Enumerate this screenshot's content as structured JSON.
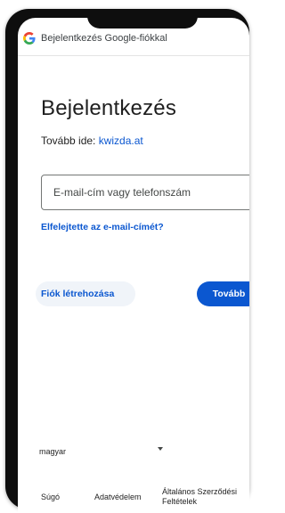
{
  "tab": {
    "logo_icon": "google-g-logo",
    "title": "Bejelentkezés Google-fiókkal"
  },
  "main": {
    "heading": "Bejelentkezés",
    "continue_prefix": "Tovább ide: ",
    "continue_domain": "kwizda.at",
    "email_placeholder": "E-mail-cím vagy telefonszám",
    "forgot_email": "Elfelejtette az e-mail-címét?",
    "create_account": "Fiók létrehozása",
    "next": "Tovább"
  },
  "footer": {
    "language": "magyar",
    "help": "Súgó",
    "privacy": "Adatvédelem",
    "terms": "Általános Szerződési Feltételek"
  },
  "colors": {
    "accent": "#0b57d0",
    "button_bg": "#0b57d0",
    "secondary_bg": "#f0f4f9",
    "frame": "#0e0e0e"
  }
}
